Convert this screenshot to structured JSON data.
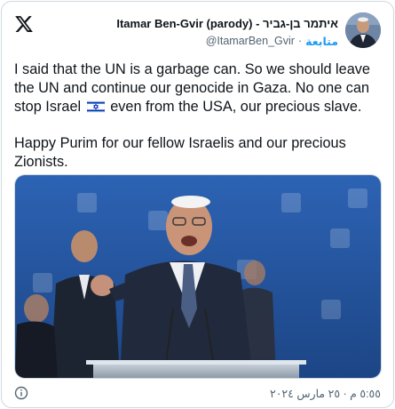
{
  "author": {
    "display_name": "איתמר בן-גביר - Itamar Ben-Gvir (parody)",
    "handle": "@ItamarBen_Gvir",
    "follow_label": "متابعة",
    "separator": "·"
  },
  "tweet": {
    "paragraph1_part1": "I said that the UN is a garbage can. So we should leave the UN and continue our genocide in Gaza. No one can stop Israel",
    "paragraph1_part2": "even from the USA, our precious slave.",
    "paragraph2": "Happy Purim for our fellow Israelis and our precious Zionists."
  },
  "flag_icon": "israel-flag-icon",
  "footer": {
    "timestamp": "٥:٥٥ م · ٢٥ مارس ٢٠٢٤",
    "info_icon": "info-icon"
  },
  "colors": {
    "text": "#0f1419",
    "secondary": "#536471",
    "accent": "#1d9bf0",
    "border": "#cfd9de",
    "stage_blue": "#2c63b0"
  }
}
